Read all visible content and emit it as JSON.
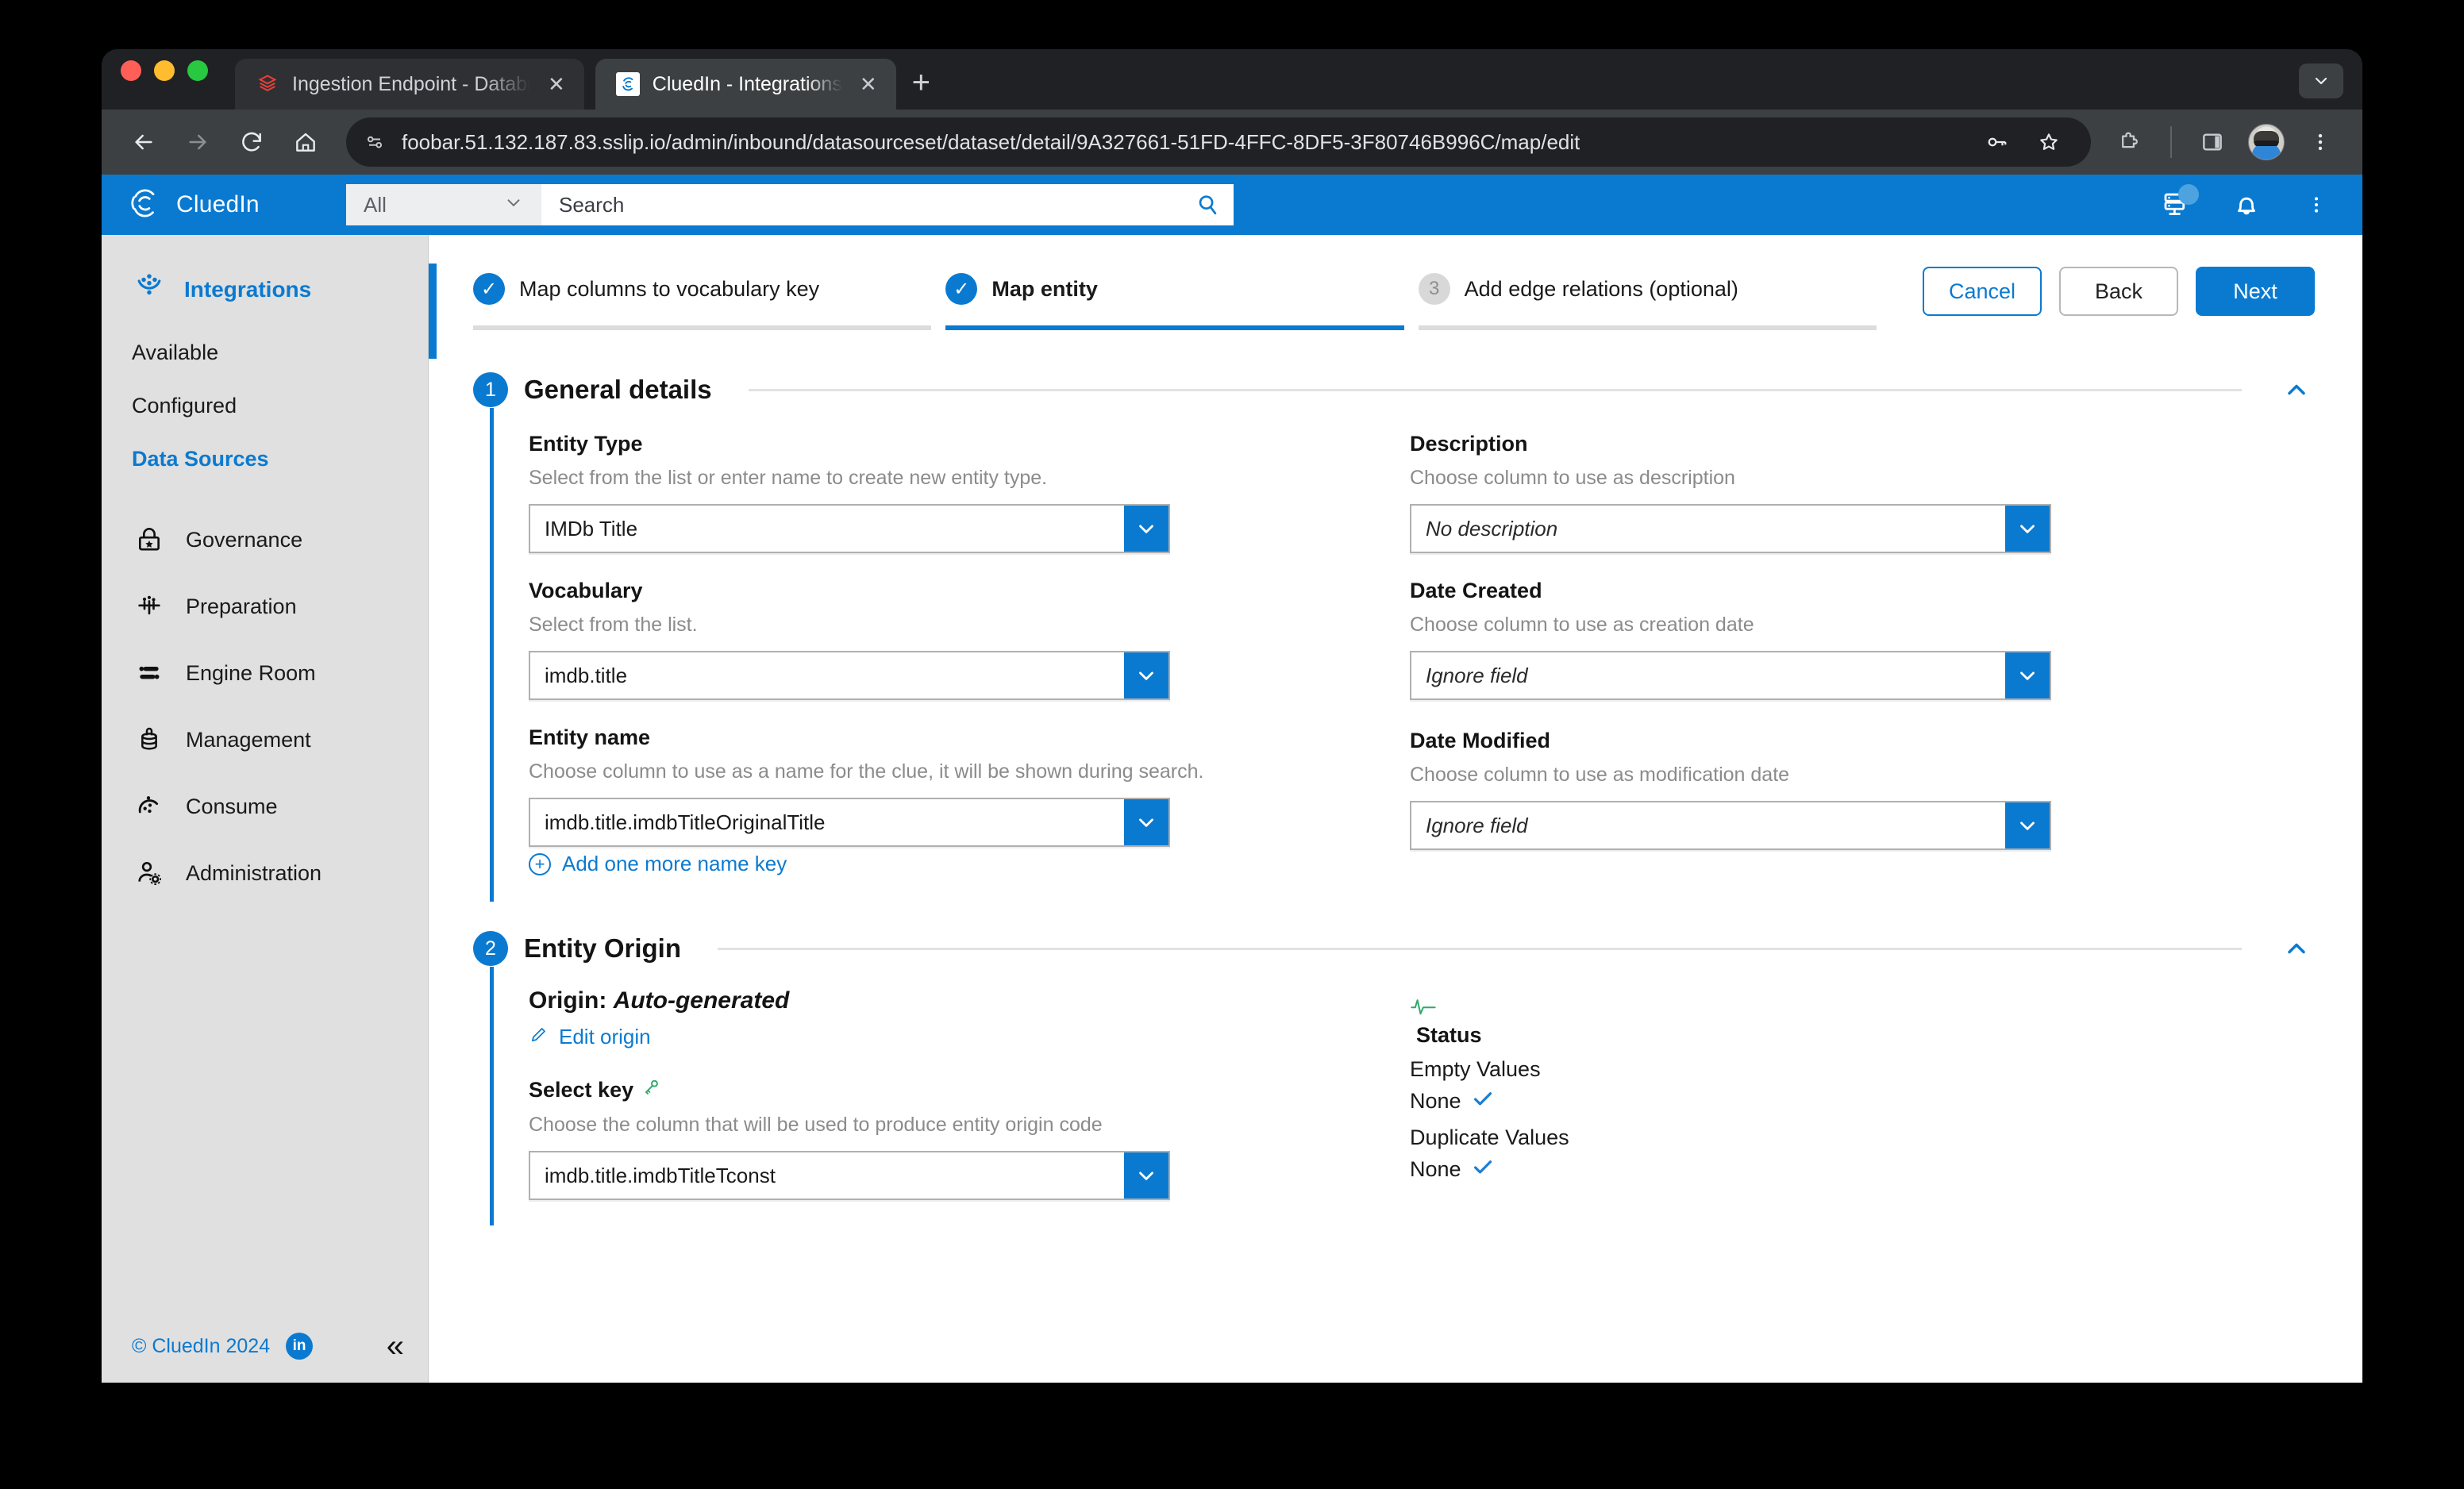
{
  "browser": {
    "tabs": [
      {
        "title": "Ingestion Endpoint - Databricks",
        "favicon": "databricks-icon",
        "active": false,
        "close_label": "✕"
      },
      {
        "title": "CluedIn - Integrations",
        "favicon": "cluedin-icon",
        "active": true,
        "close_label": "✕"
      }
    ],
    "new_tab_label": "+",
    "url": "foobar.51.132.187.83.sslip.io/admin/inbound/datasourceset/dataset/detail/9A327661-51FD-4FFC-8DF5-3F80746B996C/map/edit",
    "toolbar_icons": [
      "back-icon",
      "forward-icon",
      "reload-icon",
      "home-icon",
      "site-info-icon",
      "password-key-icon",
      "bookmark-star-icon",
      "extensions-icon",
      "side-panel-icon",
      "profile-avatar",
      "browser-menu-icon"
    ]
  },
  "app_header": {
    "brand": "CluedIn",
    "search_scope": "All",
    "search_placeholder": "Search",
    "search_value": "",
    "icons": [
      "server-status-icon",
      "notifications-bell-icon",
      "overflow-menu-icon"
    ]
  },
  "sidebar": {
    "section": {
      "label": "Integrations",
      "icon": "integrations-icon"
    },
    "links": [
      {
        "label": "Available",
        "active": false
      },
      {
        "label": "Configured",
        "active": false
      },
      {
        "label": "Data Sources",
        "active": true
      }
    ],
    "items": [
      {
        "label": "Governance",
        "icon": "lock-star-icon"
      },
      {
        "label": "Preparation",
        "icon": "preparation-icon"
      },
      {
        "label": "Engine Room",
        "icon": "engine-room-icon"
      },
      {
        "label": "Management",
        "icon": "database-icon"
      },
      {
        "label": "Consume",
        "icon": "consume-icon"
      },
      {
        "label": "Administration",
        "icon": "user-gear-icon"
      }
    ],
    "footer": {
      "copyright": "© CluedIn  2024",
      "linkedin": "in",
      "collapse": "«"
    }
  },
  "wizard": {
    "steps": [
      {
        "label": "Map columns to vocabulary key",
        "badge": "✓",
        "state": "done"
      },
      {
        "label": "Map entity",
        "badge": "✓",
        "state": "current"
      },
      {
        "label": "Add edge relations (optional)",
        "badge": "3",
        "state": "pending"
      }
    ],
    "buttons": {
      "cancel": "Cancel",
      "back": "Back",
      "next": "Next"
    }
  },
  "sections": [
    {
      "number": "1",
      "title": "General details",
      "toggle_icon": "chevron-up-icon",
      "left_fields": [
        {
          "label": "Entity Type",
          "help": "Select from the list or enter name to create new entity type.",
          "value": "IMDb Title",
          "italic": false
        },
        {
          "label": "Vocabulary",
          "help": "Select from the list.",
          "value": "imdb.title",
          "italic": false
        },
        {
          "label": "Entity name",
          "help": "Choose column to use as a name for the clue, it will be shown during search.",
          "value": "imdb.title.imdbTitleOriginalTitle",
          "italic": false,
          "add_link": "Add one more name key"
        }
      ],
      "right_fields": [
        {
          "label": "Description",
          "help": "Choose column to use as description",
          "value": "No description",
          "italic": true
        },
        {
          "label": "Date Created",
          "help": "Choose column to use as creation date",
          "value": "Ignore field",
          "italic": true
        },
        {
          "label": "Date Modified",
          "help": "Choose column to use as modification date",
          "value": "Ignore field",
          "italic": true
        }
      ]
    },
    {
      "number": "2",
      "title": "Entity Origin",
      "toggle_icon": "chevron-up-icon",
      "origin": {
        "prefix": "Origin:",
        "value": "Auto-generated",
        "edit_link": "Edit origin"
      },
      "select_key": {
        "label": "Select key",
        "icon": "key-icon",
        "help": "Choose the column that will be used to produce entity origin code",
        "value": "imdb.title.imdbTitleTconst"
      },
      "status": {
        "icon": "pulse-icon",
        "title": "Status",
        "rows": [
          {
            "label": "Empty Values",
            "value": "None",
            "check": "✓"
          },
          {
            "label": "Duplicate Values",
            "value": "None",
            "check": "✓"
          }
        ]
      }
    }
  ],
  "colors": {
    "brand_blue": "#0a7ad1",
    "sidebar_bg": "#e0e0e0",
    "status_green": "#2eaa6b",
    "check_blue": "#1a7fd4"
  }
}
